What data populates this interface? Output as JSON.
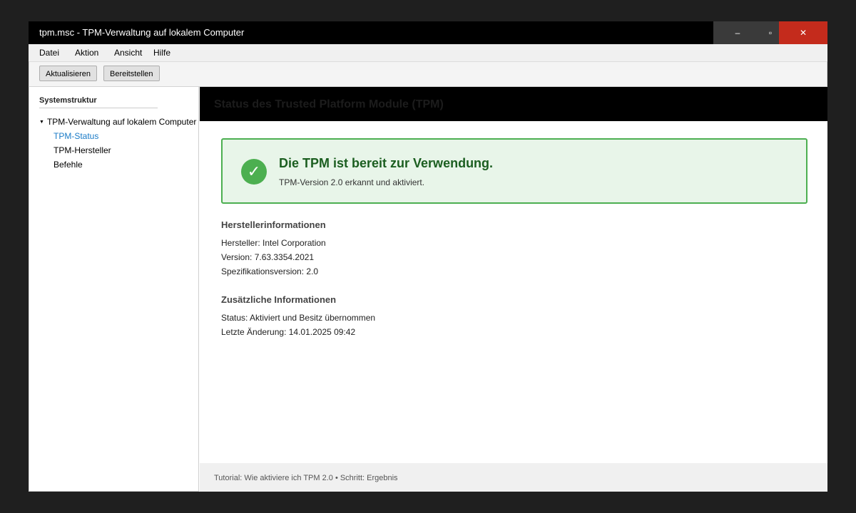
{
  "window": {
    "title": "tpm.msc - TPM-Verwaltung auf lokalem Computer",
    "controls": {
      "minimize": "–",
      "maximize": "▫",
      "close": "✕"
    }
  },
  "menu": [
    "Datei",
    "Aktion",
    "Ansicht",
    "Hilfe"
  ],
  "toolbar": {
    "refresh_label": "Aktualisieren",
    "prepare_label": "Bereitstellen"
  },
  "sidebar": {
    "heading": "Systemstruktur",
    "root": "TPM-Verwaltung auf lokalem Computer",
    "items": [
      {
        "label": "TPM-Status",
        "active": true
      },
      {
        "label": "TPM-Hersteller",
        "active": false
      },
      {
        "label": "Befehle",
        "active": false
      }
    ]
  },
  "main": {
    "header": "Status des Trusted Platform Module (TPM)",
    "status": {
      "icon": "✓",
      "title": "Die TPM ist bereit zur Verwendung.",
      "subtitle": "TPM-Version 2.0 erkannt und aktiviert."
    },
    "manufacturer": {
      "title": "Herstellerinformationen",
      "lines": [
        "Hersteller: Intel Corporation",
        "Version: 7.63.3354.2021",
        "Spezifikationsversion: 2.0"
      ]
    },
    "additional": {
      "title": "Zusätzliche Informationen",
      "lines": [
        "Status: Aktiviert und Besitz übernommen",
        "Letzte Änderung: 14.01.2025 09:42"
      ]
    },
    "footer": "Tutorial: Wie aktiviere ich TPM 2.0 • Schritt: Ergebnis"
  },
  "colors": {
    "accent": "#1a7bc7",
    "success": "#4caf50",
    "success_bg": "#e8f5e9",
    "success_text": "#1b5e20",
    "close": "#c42b1c"
  }
}
